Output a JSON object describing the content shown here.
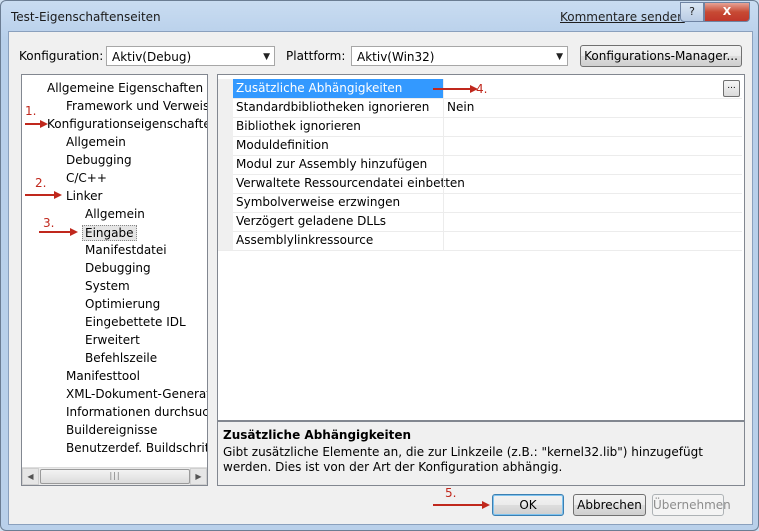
{
  "window": {
    "title": "Test-Eigenschaftenseiten",
    "comments_link": "Kommentare senden",
    "help_button": "?",
    "close_button": "X"
  },
  "toolbar": {
    "config_label": "Konfiguration:",
    "config_value": "Aktiv(Debug)",
    "platform_label": "Plattform:",
    "platform_value": "Aktiv(Win32)",
    "config_manager_button": "Konfigurations-Manager..."
  },
  "tree": {
    "items": [
      {
        "label": "Allgemeine Eigenschaften"
      },
      {
        "label": "Framework und Verweise"
      },
      {
        "label": "Konfigurationseigenschaften"
      },
      {
        "label": "Allgemein"
      },
      {
        "label": "Debugging"
      },
      {
        "label": "C/C++"
      },
      {
        "label": "Linker"
      },
      {
        "label": "Allgemein"
      },
      {
        "label": "Eingabe"
      },
      {
        "label": "Manifestdatei"
      },
      {
        "label": "Debugging"
      },
      {
        "label": "System"
      },
      {
        "label": "Optimierung"
      },
      {
        "label": "Eingebettete IDL"
      },
      {
        "label": "Erweitert"
      },
      {
        "label": "Befehlszeile"
      },
      {
        "label": "Manifesttool"
      },
      {
        "label": "XML-Dokument-Generato"
      },
      {
        "label": "Informationen durchsuche"
      },
      {
        "label": "Buildereignisse"
      },
      {
        "label": "Benutzerdef. Buildschritt"
      }
    ],
    "selected": "Eingabe"
  },
  "properties": {
    "rows": [
      {
        "name": "Zusätzliche Abhängigkeiten",
        "value": ""
      },
      {
        "name": "Standardbibliotheken ignorieren",
        "value": "Nein"
      },
      {
        "name": "Bibliothek ignorieren",
        "value": ""
      },
      {
        "name": "Moduldefinition",
        "value": ""
      },
      {
        "name": "Modul zur Assembly hinzufügen",
        "value": ""
      },
      {
        "name": "Verwaltete Ressourcendatei einbetten",
        "value": ""
      },
      {
        "name": "Symbolverweise erzwingen",
        "value": ""
      },
      {
        "name": "Verzögert geladene DLLs",
        "value": ""
      },
      {
        "name": "Assemblylinkressource",
        "value": ""
      }
    ],
    "ellipsis": "..."
  },
  "description": {
    "title": "Zusätzliche Abhängigkeiten",
    "text": "Gibt zusätzliche Elemente an, die zur Linkzeile (z.B.: \"kernel32.lib\") hinzugefügt werden. Dies ist von der Art der Konfiguration abhängig."
  },
  "buttons": {
    "ok": "OK",
    "cancel": "Abbrechen",
    "apply": "Übernehmen"
  },
  "annotations": {
    "n1": "1.",
    "n2": "2.",
    "n3": "3.",
    "n4": "4.",
    "n5": "5.",
    "color": "#c0281d"
  }
}
